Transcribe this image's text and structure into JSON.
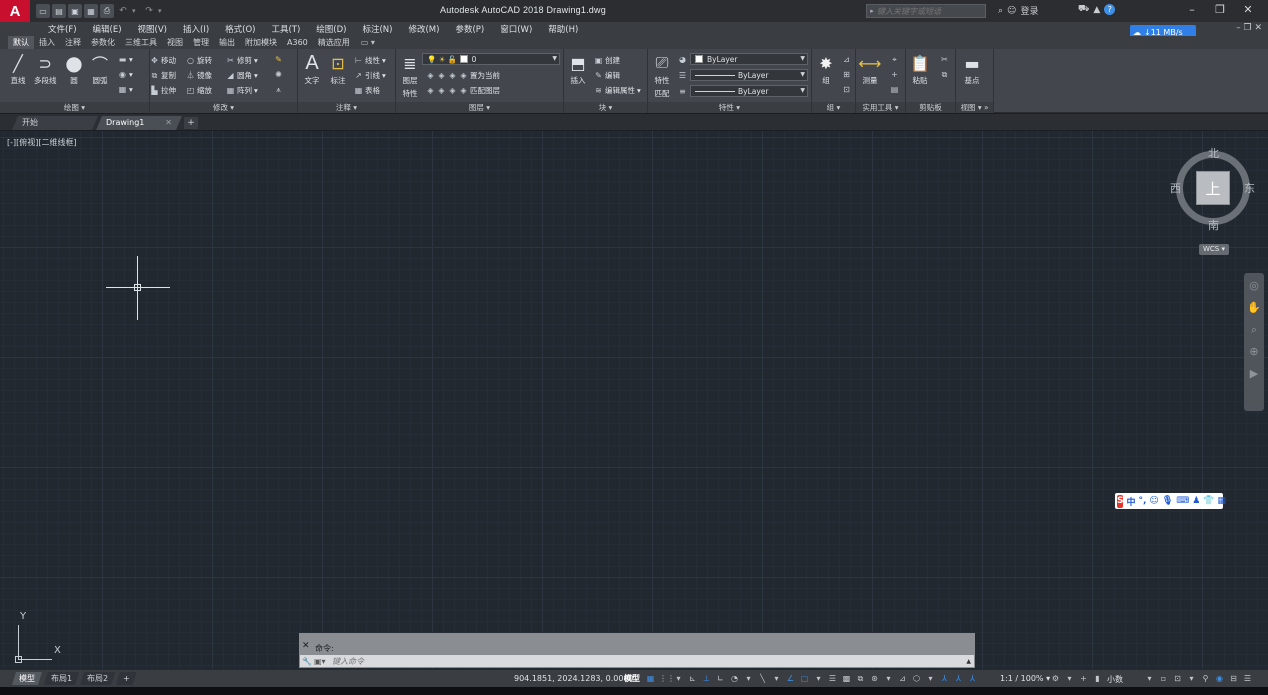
{
  "app": {
    "title": "Autodesk AutoCAD 2018    Drawing1.dwg",
    "logo": "A",
    "search_placeholder": "键入关键字或短语",
    "login": "登录",
    "speed": "↓11 MB/s"
  },
  "menu": [
    "文件(F)",
    "编辑(E)",
    "视图(V)",
    "插入(I)",
    "格式(O)",
    "工具(T)",
    "绘图(D)",
    "标注(N)",
    "修改(M)",
    "参数(P)",
    "窗口(W)",
    "帮助(H)"
  ],
  "ribbon_tabs": [
    "默认",
    "插入",
    "注释",
    "参数化",
    "三维工具",
    "视图",
    "管理",
    "输出",
    "附加模块",
    "A360",
    "精选应用"
  ],
  "ribbon": {
    "draw": {
      "footer": "绘图 ▾",
      "line": "直线",
      "polyline": "多段线",
      "circle": "圆",
      "arc": "圆弧"
    },
    "modify": {
      "footer": "修改 ▾",
      "move": "移动",
      "rotate": "旋转",
      "trim": "修剪",
      "copy": "复制",
      "mirror": "镜像",
      "fillet": "圆角",
      "stretch": "拉伸",
      "scale": "缩放",
      "array": "阵列"
    },
    "annotation": {
      "footer": "注释 ▾",
      "text": "文字",
      "dimension": "标注",
      "linear": "线性",
      "leader": "引线",
      "table": "表格"
    },
    "layers": {
      "footer": "图层 ▾",
      "layer_props": "图层",
      "layer_props2": "特性",
      "current_layer": "0",
      "set_current": "置为当前",
      "match_layer": "匹配图层"
    },
    "block": {
      "footer": "块 ▾",
      "insert": "插入",
      "create": "创建",
      "edit": "编辑",
      "edit_attr": "编辑属性"
    },
    "properties": {
      "footer": "特性 ▾",
      "match": "特性",
      "match2": "匹配",
      "color": "ByLayer",
      "linetype": "ByLayer",
      "lineweight": "ByLayer"
    },
    "groups": {
      "footer": "组 ▾",
      "group": "组"
    },
    "utilities": {
      "footer": "实用工具 ▾",
      "measure": "测量"
    },
    "clipboard": {
      "footer": "剪贴板",
      "paste": "粘贴"
    },
    "view": {
      "footer": "视图 ▾ »",
      "base": "基点"
    }
  },
  "file_tabs": {
    "start": "开始",
    "drawing": "Drawing1"
  },
  "viewport": {
    "label": "[-][俯视][二维线框]",
    "cube": {
      "top": "上",
      "north": "北",
      "south": "南",
      "east": "东",
      "west": "西",
      "wcs": "WCS"
    }
  },
  "ucs": {
    "x": "X",
    "y": "Y"
  },
  "command": {
    "history": "命令:",
    "placeholder": "键入命令"
  },
  "status": {
    "layouts": [
      "模型",
      "布局1",
      "布局2"
    ],
    "coords": "904.1851, 2024.1283, 0.0000",
    "model": "模型",
    "scale": "1:1 / 100%",
    "units": "小数"
  },
  "ime": {
    "lang": "中"
  },
  "colors": {
    "accent": "#3d8fe8",
    "logo": "#c8102e",
    "canvas": "#212830"
  }
}
